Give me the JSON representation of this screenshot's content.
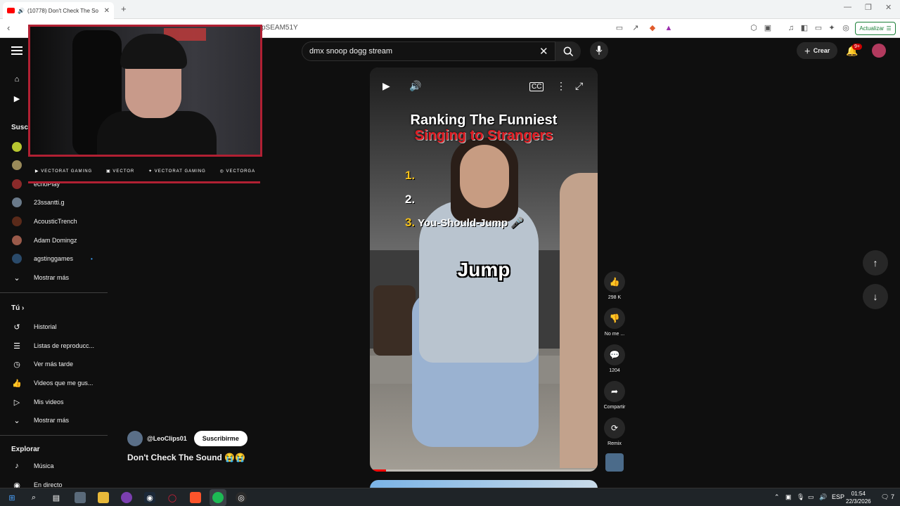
{
  "browser": {
    "tab_title": "(10778) Don't Check The So",
    "url_fragment": "pSEAM51Y",
    "update_label": "Actualizar"
  },
  "header": {
    "search_query": "dmx snoop dogg stream",
    "create_label": "Crear",
    "notification_badge": "9+"
  },
  "sidebar": {
    "subs_heading": "Susc",
    "channels": [
      {
        "name": "echoPlay",
        "color": "#8a2a2a"
      },
      {
        "name": "23ssantti.g",
        "color": "#6a7a8a"
      },
      {
        "name": "AcousticTrench",
        "color": "#5a2a1a"
      },
      {
        "name": "Adam Domingz",
        "color": "#9a5a4a"
      },
      {
        "name": "agstinggames",
        "color": "#2a4a6a"
      }
    ],
    "show_more_1": "Mostrar más",
    "you_heading": "Tú",
    "you_items": [
      "Historial",
      "Listas de reproducc...",
      "Ver más tarde",
      "Videos que me gus...",
      "Mis videos"
    ],
    "show_more_2": "Mostrar más",
    "explore_heading": "Explorar",
    "explore_items": [
      "Música",
      "En directo"
    ]
  },
  "overlay": {
    "social_1": "VECTORAT GAMING",
    "social_2": "VECTOR",
    "social_3": "VECTORAT GAMING",
    "social_4": "VECTORGA"
  },
  "short": {
    "title_line1": "Ranking The Funniest",
    "title_line2": "Singing to Strangers",
    "rank1": "1.",
    "rank2": "2.",
    "rank3_num": "3.",
    "rank3_text": "You-Should-Jump",
    "caption": "Jump",
    "progress": 0.07
  },
  "actions": {
    "likes": "298 K",
    "dislike": "No me ...",
    "comments": "1204",
    "share": "Compartir",
    "remix": "Remix"
  },
  "channel": {
    "handle": "@LeoClips01",
    "subscribe_label": "Suscribirme",
    "video_title": "Don't Check The Sound 😭😭"
  },
  "taskbar": {
    "lang": "ESP",
    "time": "01:54",
    "date": "22/3/2026",
    "notif_count": "7"
  }
}
